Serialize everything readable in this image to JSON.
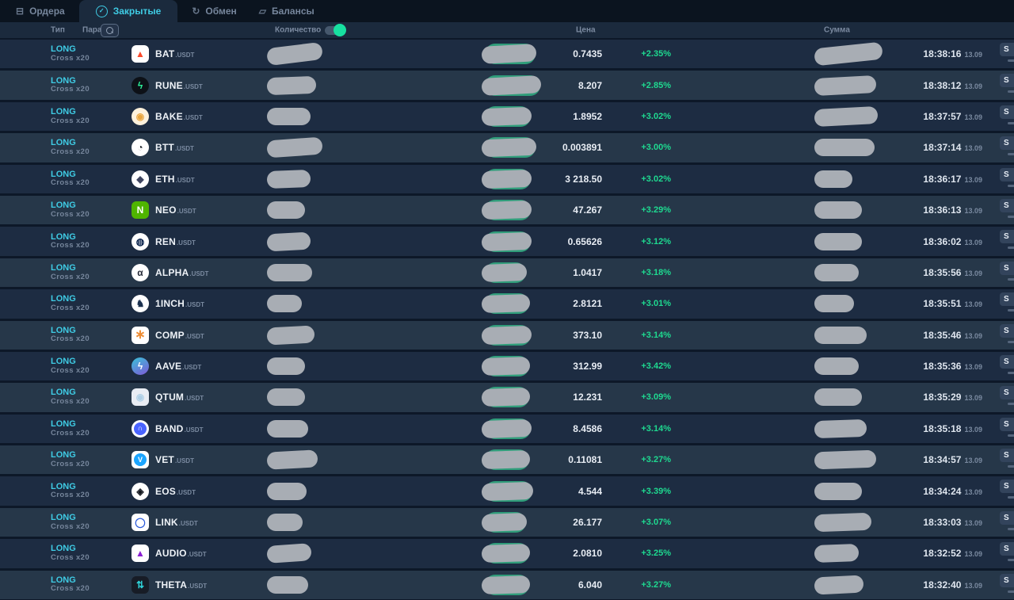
{
  "tabs": [
    {
      "label": "Ордера",
      "glyph": "⊟",
      "active": false
    },
    {
      "label": "Закрытые",
      "glyph": "✓",
      "active": true
    },
    {
      "label": "Обмен",
      "glyph": "↻",
      "active": false
    },
    {
      "label": "Балансы",
      "glyph": "▱",
      "active": false
    }
  ],
  "header": {
    "col_type": "Тип",
    "col_pair": "Пара",
    "col_quantity": "Количество",
    "col_price": "Цена",
    "col_sum": "Сумма",
    "quantity_toggle_on": true
  },
  "side_button": {
    "label": "S"
  },
  "colors": {
    "accent_cyan": "#3fcbe4",
    "positive_green": "#1ed990",
    "pill_green": "#2f9d7a",
    "redaction_gray": "#a8adb4",
    "row_dark": "#1d2c42",
    "row_light": "#263749"
  },
  "rows": [
    {
      "type": "LONG",
      "margin": "Cross x20",
      "coin": "BAT",
      "quote": ".USDT",
      "price": "0.7435",
      "change": "+2.35%",
      "time": "18:38:16",
      "date": "13.09",
      "icon": {
        "shape": "square",
        "bg": "#ffffff",
        "fg": "#fb4a2c",
        "glyph": "▲"
      },
      "qty_w": 70,
      "qty_tilt": -7,
      "price_w": 64,
      "price_tilt": -3,
      "sum_w": 86,
      "sum_tilt": -6
    },
    {
      "type": "LONG",
      "margin": "Cross x20",
      "coin": "RUNE",
      "quote": ".USDT",
      "price": "8.207",
      "change": "+2.85%",
      "time": "18:38:12",
      "date": "13.09",
      "icon": {
        "shape": "circle",
        "bg": "#0d1117",
        "fg": "#2df49b",
        "glyph": "ϟ"
      },
      "qty_w": 62,
      "qty_tilt": -2,
      "price_w": 70,
      "price_tilt": -3,
      "sum_w": 78,
      "sum_tilt": -3
    },
    {
      "type": "LONG",
      "margin": "Cross x20",
      "coin": "BAKE",
      "quote": ".USDT",
      "price": "1.8952",
      "change": "+3.02%",
      "time": "18:37:57",
      "date": "13.09",
      "icon": {
        "shape": "circle",
        "bg": "#fdf1dc",
        "fg": "#e8a43e",
        "glyph": "◉"
      },
      "qty_w": 55,
      "qty_tilt": 0,
      "price_w": 58,
      "price_tilt": -2,
      "sum_w": 80,
      "sum_tilt": -3
    },
    {
      "type": "LONG",
      "margin": "Cross x20",
      "coin": "BTT",
      "quote": ".USDT",
      "price": "0.003891",
      "change": "+3.00%",
      "time": "18:37:14",
      "date": "13.09",
      "icon": {
        "shape": "circle",
        "bg": "#ffffff",
        "fg": "#1a1e27",
        "glyph": "◔"
      },
      "qty_w": 70,
      "qty_tilt": -4,
      "price_w": 64,
      "price_tilt": -2,
      "sum_w": 76,
      "sum_tilt": 0
    },
    {
      "type": "LONG",
      "margin": "Cross x20",
      "coin": "ETH",
      "quote": ".USDT",
      "price": "3 218.50",
      "change": "+3.02%",
      "time": "18:36:17",
      "date": "13.09",
      "icon": {
        "shape": "circle",
        "bg": "#ffffff",
        "fg": "#3f4560",
        "glyph": "◆"
      },
      "qty_w": 55,
      "qty_tilt": -2,
      "price_w": 58,
      "price_tilt": -2,
      "sum_w": 48,
      "sum_tilt": 0
    },
    {
      "type": "LONG",
      "margin": "Cross x20",
      "coin": "NEO",
      "quote": ".USDT",
      "price": "47.267",
      "change": "+3.29%",
      "time": "18:36:13",
      "date": "13.09",
      "icon": {
        "shape": "square",
        "bg": "#4fb500",
        "fg": "#ffffff",
        "glyph": "N"
      },
      "qty_w": 48,
      "qty_tilt": 0,
      "price_w": 58,
      "price_tilt": -2,
      "sum_w": 60,
      "sum_tilt": 0
    },
    {
      "type": "LONG",
      "margin": "Cross x20",
      "coin": "REN",
      "quote": ".USDT",
      "price": "0.65626",
      "change": "+3.12%",
      "time": "18:36:02",
      "date": "13.09",
      "icon": {
        "shape": "circle",
        "bg": "#ffffff",
        "fg": "#07204a",
        "glyph": "◍"
      },
      "qty_w": 55,
      "qty_tilt": -3,
      "price_w": 58,
      "price_tilt": -2,
      "sum_w": 60,
      "sum_tilt": 0
    },
    {
      "type": "LONG",
      "margin": "Cross x20",
      "coin": "ALPHA",
      "quote": ".USDT",
      "price": "1.0417",
      "change": "+3.18%",
      "time": "18:35:56",
      "date": "13.09",
      "icon": {
        "shape": "circle",
        "bg": "#ffffff",
        "fg": "#232836",
        "glyph": "α"
      },
      "qty_w": 57,
      "qty_tilt": 0,
      "price_w": 52,
      "price_tilt": -2,
      "sum_w": 56,
      "sum_tilt": 0
    },
    {
      "type": "LONG",
      "margin": "Cross x20",
      "coin": "1INCH",
      "quote": ".USDT",
      "price": "2.8121",
      "change": "+3.01%",
      "time": "18:35:51",
      "date": "13.09",
      "icon": {
        "shape": "circle",
        "bg": "#ffffff",
        "fg": "#1b314f",
        "glyph": "♞"
      },
      "qty_w": 44,
      "qty_tilt": 0,
      "price_w": 56,
      "price_tilt": -2,
      "sum_w": 50,
      "sum_tilt": 0
    },
    {
      "type": "LONG",
      "margin": "Cross x20",
      "coin": "COMP",
      "quote": ".USDT",
      "price": "373.10",
      "change": "+3.14%",
      "time": "18:35:46",
      "date": "13.09",
      "icon": {
        "shape": "square",
        "bg": "#ffffff",
        "fg": "#ec8b33",
        "glyph": "∗",
        "size": 16
      },
      "qty_w": 60,
      "qty_tilt": -3,
      "price_w": 58,
      "price_tilt": -2,
      "sum_w": 66,
      "sum_tilt": 0
    },
    {
      "type": "LONG",
      "margin": "Cross x20",
      "coin": "AAVE",
      "quote": ".USDT",
      "price": "312.99",
      "change": "+3.42%",
      "time": "18:35:36",
      "date": "13.09",
      "icon": {
        "shape": "circle",
        "bg": "linear-gradient(150deg,#38c3d8,#8058d8)",
        "fg": "#ffffff",
        "glyph": "ϟ"
      },
      "qty_w": 48,
      "qty_tilt": 0,
      "price_w": 56,
      "price_tilt": -2,
      "sum_w": 56,
      "sum_tilt": 0
    },
    {
      "type": "LONG",
      "margin": "Cross x20",
      "coin": "QTUM",
      "quote": ".USDT",
      "price": "12.231",
      "change": "+3.09%",
      "time": "18:35:29",
      "date": "13.09",
      "icon": {
        "shape": "square",
        "bg": "#e9edf4",
        "fg": "#aecfe6",
        "glyph": "◉"
      },
      "qty_w": 48,
      "qty_tilt": 0,
      "price_w": 56,
      "price_tilt": -2,
      "sum_w": 60,
      "sum_tilt": 0
    },
    {
      "type": "LONG",
      "margin": "Cross x20",
      "coin": "BAND",
      "quote": ".USDT",
      "price": "8.4586",
      "change": "+3.14%",
      "time": "18:35:18",
      "date": "13.09",
      "icon": {
        "shape": "circle",
        "bg": "#ffffff",
        "inner": "#4a64ff",
        "fg": "#ffffff",
        "glyph": "∩"
      },
      "qty_w": 52,
      "qty_tilt": 0,
      "price_w": 58,
      "price_tilt": -2,
      "sum_w": 66,
      "sum_tilt": -2
    },
    {
      "type": "LONG",
      "margin": "Cross x20",
      "coin": "VET",
      "quote": ".USDT",
      "price": "0.11081",
      "change": "+3.27%",
      "time": "18:34:57",
      "date": "13.09",
      "icon": {
        "shape": "square",
        "bg": "#ffffff",
        "inner": "#1ba5ff",
        "fg": "#ffffff",
        "glyph": "V"
      },
      "qty_w": 64,
      "qty_tilt": -3,
      "price_w": 56,
      "price_tilt": -2,
      "sum_w": 78,
      "sum_tilt": -2
    },
    {
      "type": "LONG",
      "margin": "Cross x20",
      "coin": "EOS",
      "quote": ".USDT",
      "price": "4.544",
      "change": "+3.39%",
      "time": "18:34:24",
      "date": "13.09",
      "icon": {
        "shape": "circle",
        "bg": "#ffffff",
        "fg": "#10141c",
        "glyph": "◈"
      },
      "qty_w": 50,
      "qty_tilt": 0,
      "price_w": 60,
      "price_tilt": -2,
      "sum_w": 60,
      "sum_tilt": 0
    },
    {
      "type": "LONG",
      "margin": "Cross x20",
      "coin": "LINK",
      "quote": ".USDT",
      "price": "26.177",
      "change": "+3.07%",
      "time": "18:33:03",
      "date": "13.09",
      "icon": {
        "shape": "square",
        "bg": "#ffffff",
        "fg": "#2a5ada",
        "glyph": "◯"
      },
      "qty_w": 45,
      "qty_tilt": 0,
      "price_w": 52,
      "price_tilt": -2,
      "sum_w": 72,
      "sum_tilt": -2
    },
    {
      "type": "LONG",
      "margin": "Cross x20",
      "coin": "AUDIO",
      "quote": ".USDT",
      "price": "2.0810",
      "change": "+3.25%",
      "time": "18:32:52",
      "date": "13.09",
      "icon": {
        "shape": "square",
        "bg": "#ffffff",
        "fg": "#8b1fd3",
        "glyph": "▲"
      },
      "qty_w": 56,
      "qty_tilt": -4,
      "price_w": 56,
      "price_tilt": -2,
      "sum_w": 56,
      "sum_tilt": -2
    },
    {
      "type": "LONG",
      "margin": "Cross x20",
      "coin": "THETA",
      "quote": ".USDT",
      "price": "6.040",
      "change": "+3.27%",
      "time": "18:32:40",
      "date": "13.09",
      "icon": {
        "shape": "square",
        "bg": "#171c26",
        "fg": "#2fd3da",
        "glyph": "⇅"
      },
      "qty_w": 52,
      "qty_tilt": 0,
      "price_w": 56,
      "price_tilt": -2,
      "sum_w": 62,
      "sum_tilt": -3
    }
  ]
}
